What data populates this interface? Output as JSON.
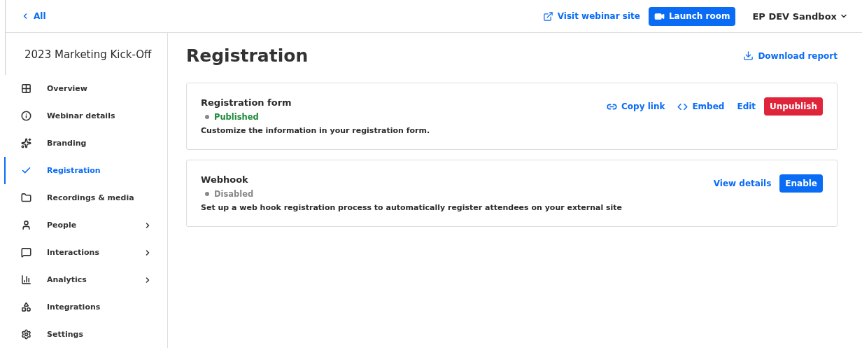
{
  "topbar": {
    "back_link": "All",
    "visit_link": "Visit webinar site",
    "launch_button": "Launch room",
    "account": "EP DEV Sandbox"
  },
  "sidebar": {
    "title": "2023 Marketing Kick-Off",
    "items": [
      {
        "label": "Overview",
        "selected": false,
        "expandable": false
      },
      {
        "label": "Webinar details",
        "selected": false,
        "expandable": false
      },
      {
        "label": "Branding",
        "selected": false,
        "expandable": false
      },
      {
        "label": "Registration",
        "selected": true,
        "expandable": false
      },
      {
        "label": "Recordings & media",
        "selected": false,
        "expandable": false
      },
      {
        "label": "People",
        "selected": false,
        "expandable": true
      },
      {
        "label": "Interactions",
        "selected": false,
        "expandable": true
      },
      {
        "label": "Analytics",
        "selected": false,
        "expandable": true
      },
      {
        "label": "Integrations",
        "selected": false,
        "expandable": false
      },
      {
        "label": "Settings",
        "selected": false,
        "expandable": false
      }
    ]
  },
  "page": {
    "title": "Registration",
    "download_link": "Download report"
  },
  "cards": [
    {
      "title": "Registration form",
      "status": {
        "label": "Published",
        "color": "#1e8a3a"
      },
      "description": "Customize the information in your registration form.",
      "actions": [
        {
          "label": "Copy link",
          "kind": "copy"
        },
        {
          "label": "Embed",
          "kind": "embed"
        },
        {
          "label": "Edit",
          "kind": "plain"
        },
        {
          "label": "Unpublish",
          "kind": "danger"
        }
      ]
    },
    {
      "title": "Webhook",
      "status": {
        "label": "Disabled",
        "color": "#888888"
      },
      "description": "Set up a web hook registration process to automatically register attendees on your external site",
      "actions": [
        {
          "label": "View details",
          "kind": "plain"
        },
        {
          "label": "Enable",
          "kind": "primary"
        }
      ]
    }
  ]
}
